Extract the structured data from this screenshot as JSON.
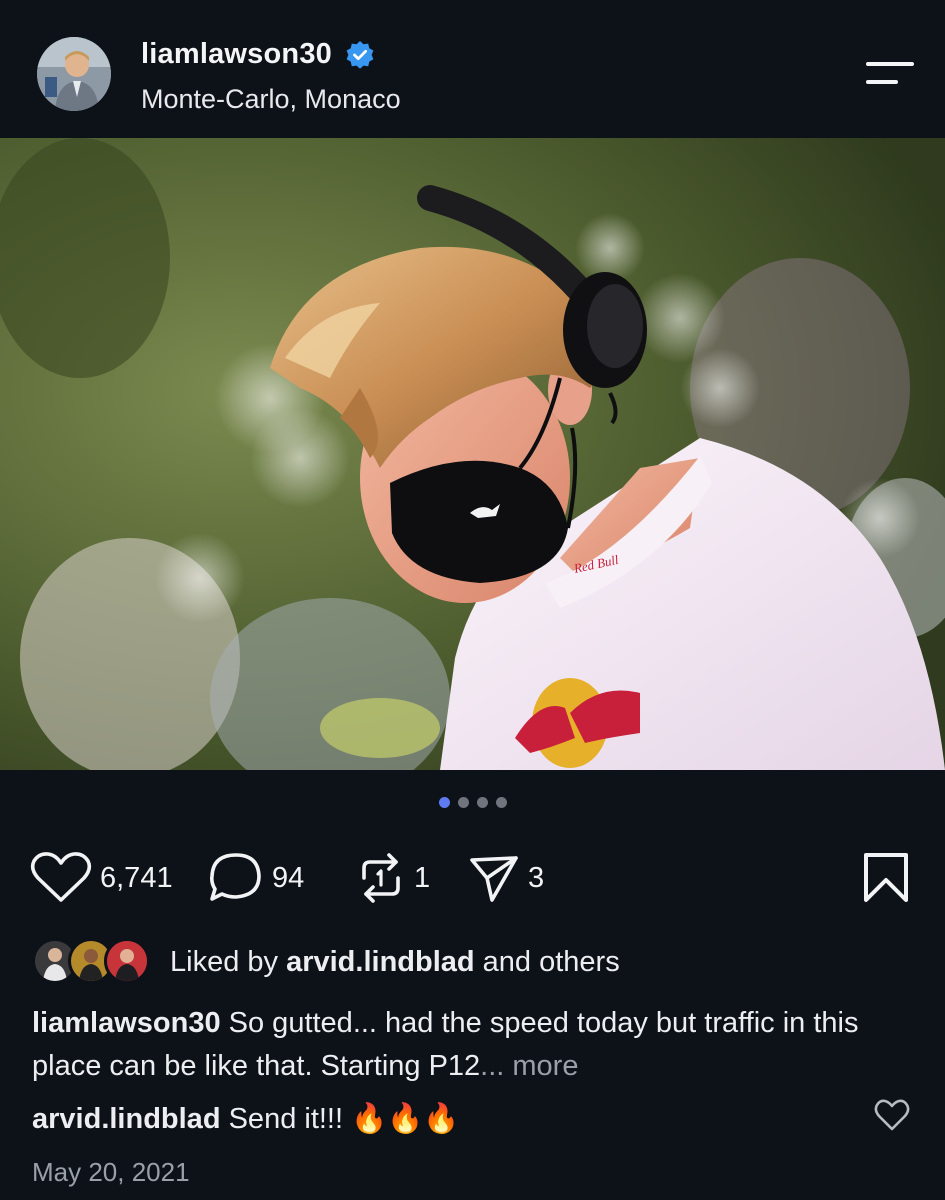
{
  "header": {
    "username": "liamlawson30",
    "location": "Monte-Carlo, Monaco",
    "verified": true
  },
  "photo": {
    "logo_text": "Red Bull"
  },
  "pagination": {
    "total": 4,
    "active_index": 0
  },
  "actions": {
    "likes": "6,741",
    "comments": "94",
    "reposts": "1",
    "shares": "3"
  },
  "liked_by": {
    "prefix": "Liked by",
    "user": "arvid.lindblad",
    "suffix": "and others"
  },
  "caption": {
    "user": "liamlawson30",
    "text": "So gutted... had the speed today but traffic in this place can be like that. Starting P12",
    "more": "... more"
  },
  "comment": {
    "user": "arvid.lindblad",
    "text": "Send it!!! 🔥🔥🔥"
  },
  "date": "May 20, 2021",
  "colors": {
    "background": "#0d1118",
    "verified": "#3897f0",
    "active_dot": "#5e7cf2"
  }
}
